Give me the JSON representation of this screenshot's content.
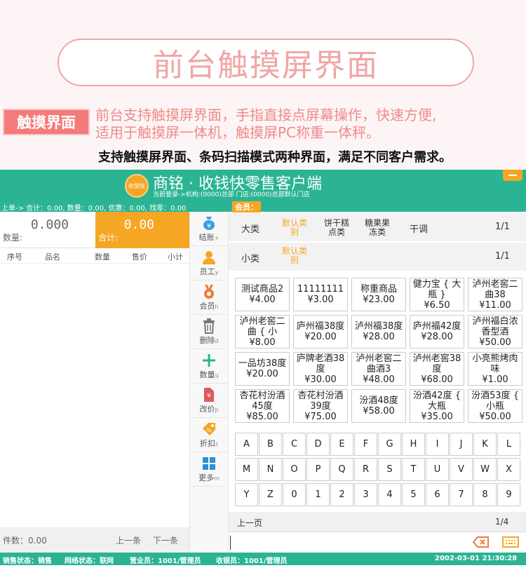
{
  "promo": {
    "banner_title": "前台触摸屏界面",
    "tag_label": "触摸界面",
    "desc_line1": "前台支持触摸屏界面，手指直接点屏幕操作，快速方便,",
    "desc_line2": "适用于触摸屏一体机，触摸屏PC称重一体秤。",
    "support_line": "支持触摸屏界面、条码扫描模式两种界面，满足不同客户需求。"
  },
  "header": {
    "logo_text": "收银快",
    "app_title": "商铭 · 收钱快零售客户端",
    "login_info": "当前登录->机构:(0000)总部 门店:(0000)总部默认门店",
    "summary": "上单-> 合计：0.00, 数量：0.00, 优惠：0.00, 找零：0.00",
    "member_label": "会员："
  },
  "totals": {
    "qty_value": "0.000",
    "qty_label": "数量:",
    "total_value": "0.00",
    "total_label": "合计:"
  },
  "table": {
    "columns": [
      "序号",
      "品名",
      "数量",
      "售价",
      "小计"
    ]
  },
  "left_footer": {
    "count_label": "件数：0.00",
    "prev": "上一条",
    "next": "下一条"
  },
  "toolbar": [
    {
      "label": "结账",
      "key": "+",
      "icon": "money-bag-icon",
      "color": "#3a9ee0"
    },
    {
      "label": "员工",
      "key": "y",
      "icon": "staff-icon",
      "color": "#f5a623"
    },
    {
      "label": "会员",
      "key": "h",
      "icon": "medal-icon",
      "color": "#f07b3b"
    },
    {
      "label": "删除",
      "key": "d",
      "icon": "trash-icon",
      "color": "#777777"
    },
    {
      "label": "数量",
      "key": "q",
      "icon": "plus-icon",
      "color": "#2bb493"
    },
    {
      "label": "改价",
      "key": "p",
      "icon": "price-tag-icon",
      "color": "#e05a5a"
    },
    {
      "label": "折扣",
      "key": "z",
      "icon": "discount-tag-icon",
      "color": "#f5a623"
    },
    {
      "label": "更多",
      "key": "m",
      "icon": "grid-icon",
      "color": "#2d8fd8"
    }
  ],
  "categories": {
    "major_label": "大类",
    "major_items": [
      "默认类别",
      "饼干糕点类",
      "糖果果冻类",
      "干调"
    ],
    "major_page": "1/1",
    "minor_label": "小类",
    "minor_items": [
      "默认类别"
    ],
    "minor_page": "1/1"
  },
  "products": [
    {
      "name": "测试商品2",
      "price": "¥4.00"
    },
    {
      "name": "11111111",
      "price": "¥3.00"
    },
    {
      "name": "称重商品",
      "price": "¥23.00"
    },
    {
      "name": "健力宝 { 大瓶 }",
      "price": "¥6.50"
    },
    {
      "name": "泸州老窖二曲38",
      "price": "¥11.00"
    },
    {
      "name": "泸州老窖二曲 { 小",
      "price": "¥8.00"
    },
    {
      "name": "庐州福38度",
      "price": "¥20.00"
    },
    {
      "name": "泸州福38度",
      "price": "¥28.00"
    },
    {
      "name": "庐州福42度",
      "price": "¥28.00"
    },
    {
      "name": "泸州福白浓香型酒",
      "price": "¥50.00"
    },
    {
      "name": "一品坊38度",
      "price": "¥20.00"
    },
    {
      "name": "庐牌老酒38度",
      "price": "¥30.00"
    },
    {
      "name": "泸州老窖二曲酒3",
      "price": "¥48.00"
    },
    {
      "name": "泸州老窖38度",
      "price": "¥68.00"
    },
    {
      "name": "小亮熊烤肉味",
      "price": "¥1.00"
    },
    {
      "name": "杏花村汾酒45度",
      "price": "¥85.00"
    },
    {
      "name": "杏花村汾酒39度",
      "price": "¥75.00"
    },
    {
      "name": "汾酒48度",
      "price": "¥58.00"
    },
    {
      "name": "汾酒42度 { 大瓶",
      "price": "¥35.00"
    },
    {
      "name": "汾酒53度 { 小瓶",
      "price": "¥50.00"
    }
  ],
  "keyboard": [
    [
      "A",
      "B",
      "C",
      "D",
      "E",
      "F",
      "G",
      "H",
      "I",
      "J",
      "K",
      "L"
    ],
    [
      "M",
      "N",
      "O",
      "P",
      "Q",
      "R",
      "S",
      "T",
      "U",
      "V",
      "W",
      "X"
    ],
    [
      "Y",
      "Z",
      "0",
      "1",
      "2",
      "3",
      "4",
      "5",
      "6",
      "7",
      "8",
      "9"
    ]
  ],
  "pager": {
    "prev_page": "上一页",
    "page": "1/4"
  },
  "input": {
    "value": ""
  },
  "status": {
    "sale_state": "销售状态：销售",
    "network": "网络状态：联网",
    "salesperson": "营业员：1001/管理员",
    "cashier": "收银员：1001/管理员",
    "datetime": "2002-03-01 21:30:28"
  },
  "colors": {
    "primary": "#2bb493",
    "accent": "#f5a623",
    "promo_pink": "#f47b7b"
  }
}
